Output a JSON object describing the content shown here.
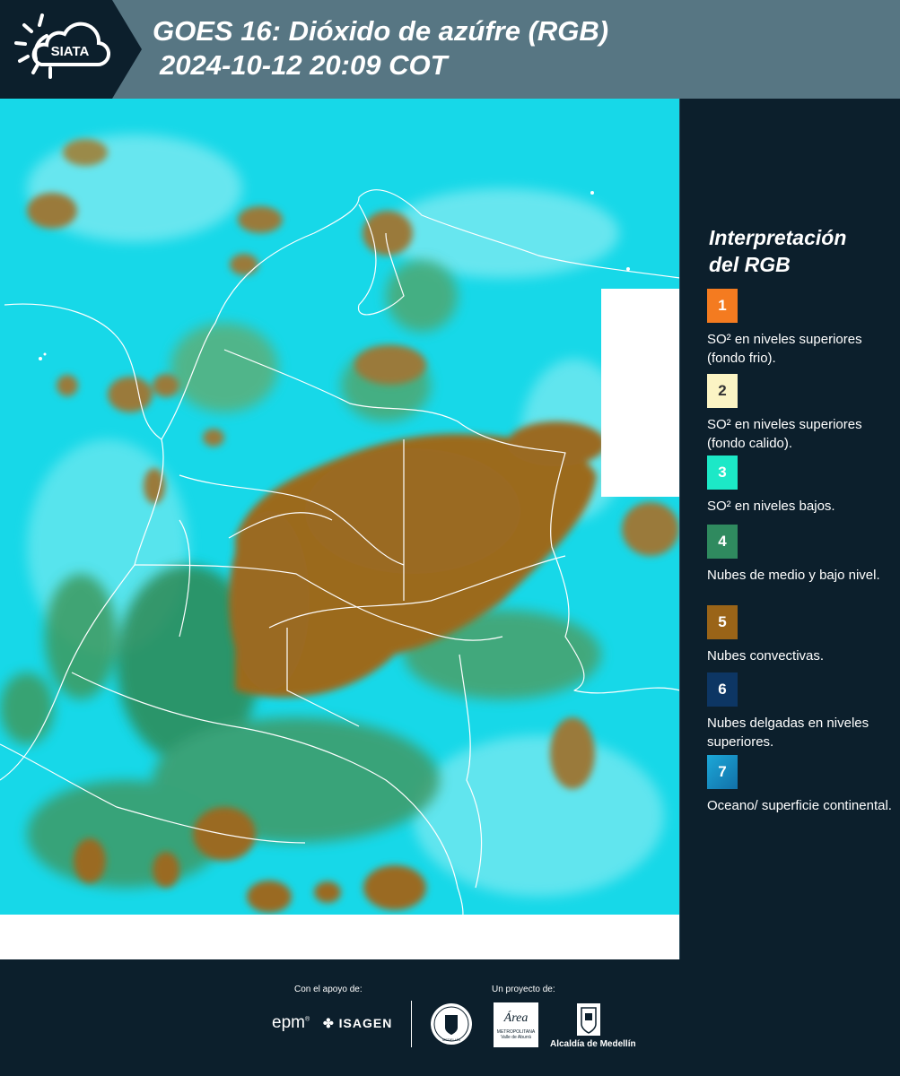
{
  "header": {
    "logo_text": "SIATA",
    "title_line1": "GOES 16: Dióxido de azúfre (RGB)",
    "title_line2": "2024-10-12 20:09 COT"
  },
  "legend": {
    "title_line1": "Interpretación",
    "title_line2": "del RGB",
    "items": [
      {
        "number": "1",
        "color": "#f47b20",
        "label": "SO² en niveles superiores (fondo frio)."
      },
      {
        "number": "2",
        "color": "#fbf4c4",
        "label": "SO² en niveles superiores (fondo calido)."
      },
      {
        "number": "3",
        "color": "#1ce8c7",
        "label": "SO² en niveles bajos."
      },
      {
        "number": "4",
        "color": "#2f8a5f",
        "label": "Nubes de medio y bajo nivel."
      },
      {
        "number": "5",
        "color": "#9a6418",
        "label": "Nubes convectivas."
      },
      {
        "number": "6",
        "color": "#0d3664",
        "label": "Nubes delgadas en niveles superiores."
      },
      {
        "number": "7",
        "color": "#1b93c8",
        "label": "Oceano/ superficie continental."
      }
    ]
  },
  "footer": {
    "support_label": "Con el apoyo de:",
    "project_label": "Un proyecto de:",
    "epm": "epm",
    "isagen": "ISAGEN",
    "area_name": "Área",
    "area_sub1": "METROPOLITANA",
    "area_sub2": "Valle de Aburrá",
    "alcaldia": "Alcaldía de Medellín",
    "medellin_seal": "MEDELLÍN"
  },
  "colors": {
    "header_bg": "#577683",
    "panel_bg": "#0c1f2c",
    "ocean": "#16d6e6",
    "convective": "#9a6418"
  }
}
